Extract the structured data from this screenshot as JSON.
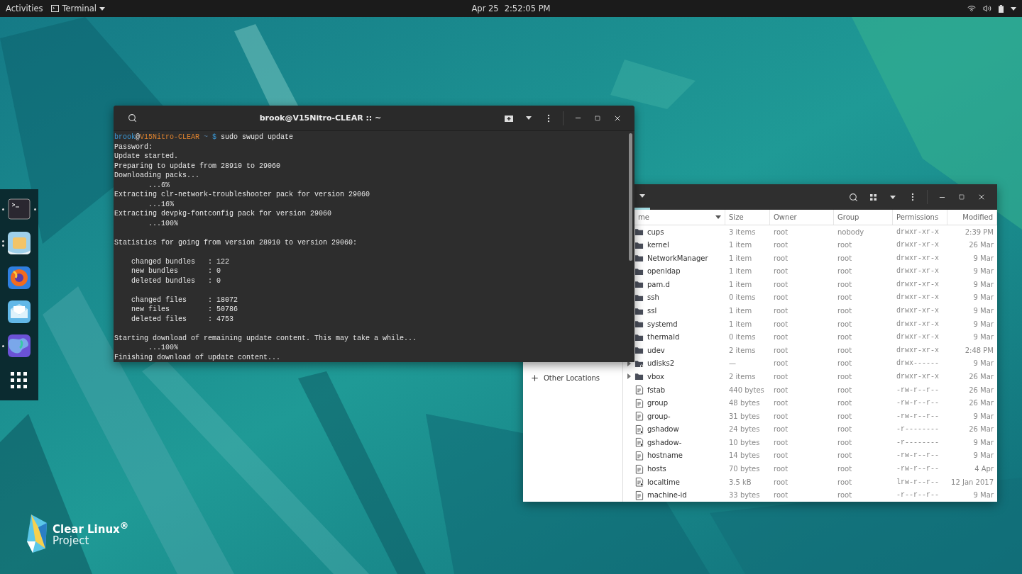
{
  "top_bar": {
    "activities": "Activities",
    "app_menu": "Terminal",
    "date": "Apr 25",
    "time": "2:52:05 PM"
  },
  "dock": {
    "items": [
      {
        "kind": "terminal",
        "running": true,
        "multiple": false,
        "focused": true
      },
      {
        "kind": "files",
        "running": true,
        "multiple": true,
        "focused": false
      },
      {
        "kind": "browser",
        "running": false,
        "focused": false
      },
      {
        "kind": "mail",
        "running": false,
        "focused": false
      },
      {
        "kind": "globe",
        "running": true,
        "multiple": false,
        "focused": false
      },
      {
        "kind": "apps",
        "running": false,
        "focused": false
      }
    ]
  },
  "terminal": {
    "title": "brook@V15Nitro-CLEAR :: ~",
    "lines": [
      {
        "kind": "prompt",
        "user": "brook",
        "at": "@",
        "host": "V15Nitro-CLEAR",
        "path": "~",
        "symbol": "$",
        "command": "sudo swupd update"
      },
      {
        "kind": "output",
        "text": "Password:"
      },
      {
        "kind": "output",
        "text": "Update started."
      },
      {
        "kind": "output",
        "text": "Preparing to update from 28910 to 29060"
      },
      {
        "kind": "output",
        "text": "Downloading packs..."
      },
      {
        "kind": "output",
        "text": "        ...6%"
      },
      {
        "kind": "output",
        "text": "Extracting clr-network-troubleshooter pack for version 29060"
      },
      {
        "kind": "output",
        "text": "        ...16%"
      },
      {
        "kind": "output",
        "text": "Extracting devpkg-fontconfig pack for version 29060"
      },
      {
        "kind": "output",
        "text": "        ...100%"
      },
      {
        "kind": "blank"
      },
      {
        "kind": "output",
        "text": "Statistics for going from version 28910 to version 29060:"
      },
      {
        "kind": "blank"
      },
      {
        "kind": "output",
        "text": "    changed bundles   : 122"
      },
      {
        "kind": "output",
        "text": "    new bundles       : 0"
      },
      {
        "kind": "output",
        "text": "    deleted bundles   : 0"
      },
      {
        "kind": "blank"
      },
      {
        "kind": "output",
        "text": "    changed files     : 18072"
      },
      {
        "kind": "output",
        "text": "    new files         : 50786"
      },
      {
        "kind": "output",
        "text": "    deleted files     : 4753"
      },
      {
        "kind": "blank"
      },
      {
        "kind": "output",
        "text": "Starting download of remaining update content. This may take a while..."
      },
      {
        "kind": "output",
        "text": "        ...100%"
      },
      {
        "kind": "output",
        "text": "Finishing download of update content..."
      }
    ]
  },
  "files": {
    "sidebar": {
      "items": [
        {
          "label": "Other Locations"
        }
      ]
    },
    "columns": [
      "me",
      "Size",
      "Owner",
      "Group",
      "Permissions",
      "Modified"
    ],
    "rows": [
      {
        "kind": "folder",
        "expandable": false,
        "name": "cups",
        "size": "3 items",
        "owner": "root",
        "group": "nobody",
        "permissions": "drwxr-xr-x",
        "modified": "2:39 PM"
      },
      {
        "kind": "folder",
        "expandable": false,
        "name": "kernel",
        "size": "1 item",
        "owner": "root",
        "group": "root",
        "permissions": "drwxr-xr-x",
        "modified": "26 Mar"
      },
      {
        "kind": "folder",
        "expandable": false,
        "name": "NetworkManager",
        "size": "1 item",
        "owner": "root",
        "group": "root",
        "permissions": "drwxr-xr-x",
        "modified": "9 Mar"
      },
      {
        "kind": "folder",
        "expandable": false,
        "name": "openldap",
        "size": "1 item",
        "owner": "root",
        "group": "root",
        "permissions": "drwxr-xr-x",
        "modified": "9 Mar"
      },
      {
        "kind": "folder",
        "expandable": false,
        "name": "pam.d",
        "size": "1 item",
        "owner": "root",
        "group": "root",
        "permissions": "drwxr-xr-x",
        "modified": "9 Mar"
      },
      {
        "kind": "folder",
        "expandable": false,
        "name": "ssh",
        "size": "0 items",
        "owner": "root",
        "group": "root",
        "permissions": "drwxr-xr-x",
        "modified": "9 Mar"
      },
      {
        "kind": "folder",
        "expandable": false,
        "name": "ssl",
        "size": "1 item",
        "owner": "root",
        "group": "root",
        "permissions": "drwxr-xr-x",
        "modified": "9 Mar"
      },
      {
        "kind": "folder",
        "expandable": false,
        "name": "systemd",
        "size": "1 item",
        "owner": "root",
        "group": "root",
        "permissions": "drwxr-xr-x",
        "modified": "9 Mar"
      },
      {
        "kind": "folder",
        "expandable": false,
        "name": "thermald",
        "size": "0 items",
        "owner": "root",
        "group": "root",
        "permissions": "drwxr-xr-x",
        "modified": "9 Mar"
      },
      {
        "kind": "folder",
        "expandable": false,
        "name": "udev",
        "size": "2 items",
        "owner": "root",
        "group": "root",
        "permissions": "drwxr-xr-x",
        "modified": "2:48 PM"
      },
      {
        "kind": "folder-special",
        "expandable": true,
        "name": "udisks2",
        "size": "—",
        "owner": "root",
        "group": "root",
        "permissions": "drwx------",
        "modified": "9 Mar"
      },
      {
        "kind": "folder",
        "expandable": true,
        "name": "vbox",
        "size": "2 items",
        "owner": "root",
        "group": "root",
        "permissions": "drwxr-xr-x",
        "modified": "26 Mar"
      },
      {
        "kind": "file",
        "expandable": false,
        "name": "fstab",
        "size": "440 bytes",
        "owner": "root",
        "group": "root",
        "permissions": "-rw-r--r--",
        "modified": "26 Mar"
      },
      {
        "kind": "file",
        "expandable": false,
        "name": "group",
        "size": "48 bytes",
        "owner": "root",
        "group": "root",
        "permissions": "-rw-r--r--",
        "modified": "26 Mar"
      },
      {
        "kind": "file",
        "expandable": false,
        "name": "group-",
        "size": "31 bytes",
        "owner": "root",
        "group": "root",
        "permissions": "-rw-r--r--",
        "modified": "9 Mar"
      },
      {
        "kind": "file-special",
        "expandable": false,
        "name": "gshadow",
        "size": "24 bytes",
        "owner": "root",
        "group": "root",
        "permissions": "-r--------",
        "modified": "26 Mar"
      },
      {
        "kind": "file-special",
        "expandable": false,
        "name": "gshadow-",
        "size": "10 bytes",
        "owner": "root",
        "group": "root",
        "permissions": "-r--------",
        "modified": "9 Mar"
      },
      {
        "kind": "file",
        "expandable": false,
        "name": "hostname",
        "size": "14 bytes",
        "owner": "root",
        "group": "root",
        "permissions": "-rw-r--r--",
        "modified": "9 Mar"
      },
      {
        "kind": "file",
        "expandable": false,
        "name": "hosts",
        "size": "70 bytes",
        "owner": "root",
        "group": "root",
        "permissions": "-rw-r--r--",
        "modified": "4 Apr"
      },
      {
        "kind": "file-special",
        "expandable": false,
        "name": "localtime",
        "size": "3.5 kB",
        "owner": "root",
        "group": "root",
        "permissions": "lrw-r--r--",
        "modified": "12 Jan 2017"
      },
      {
        "kind": "file",
        "expandable": false,
        "name": "machine-id",
        "size": "33 bytes",
        "owner": "root",
        "group": "root",
        "permissions": "-r--r--r--",
        "modified": "9 Mar"
      }
    ]
  },
  "logo": {
    "name": "Clear Linux$^{®}$",
    "subtitle": "Project"
  }
}
